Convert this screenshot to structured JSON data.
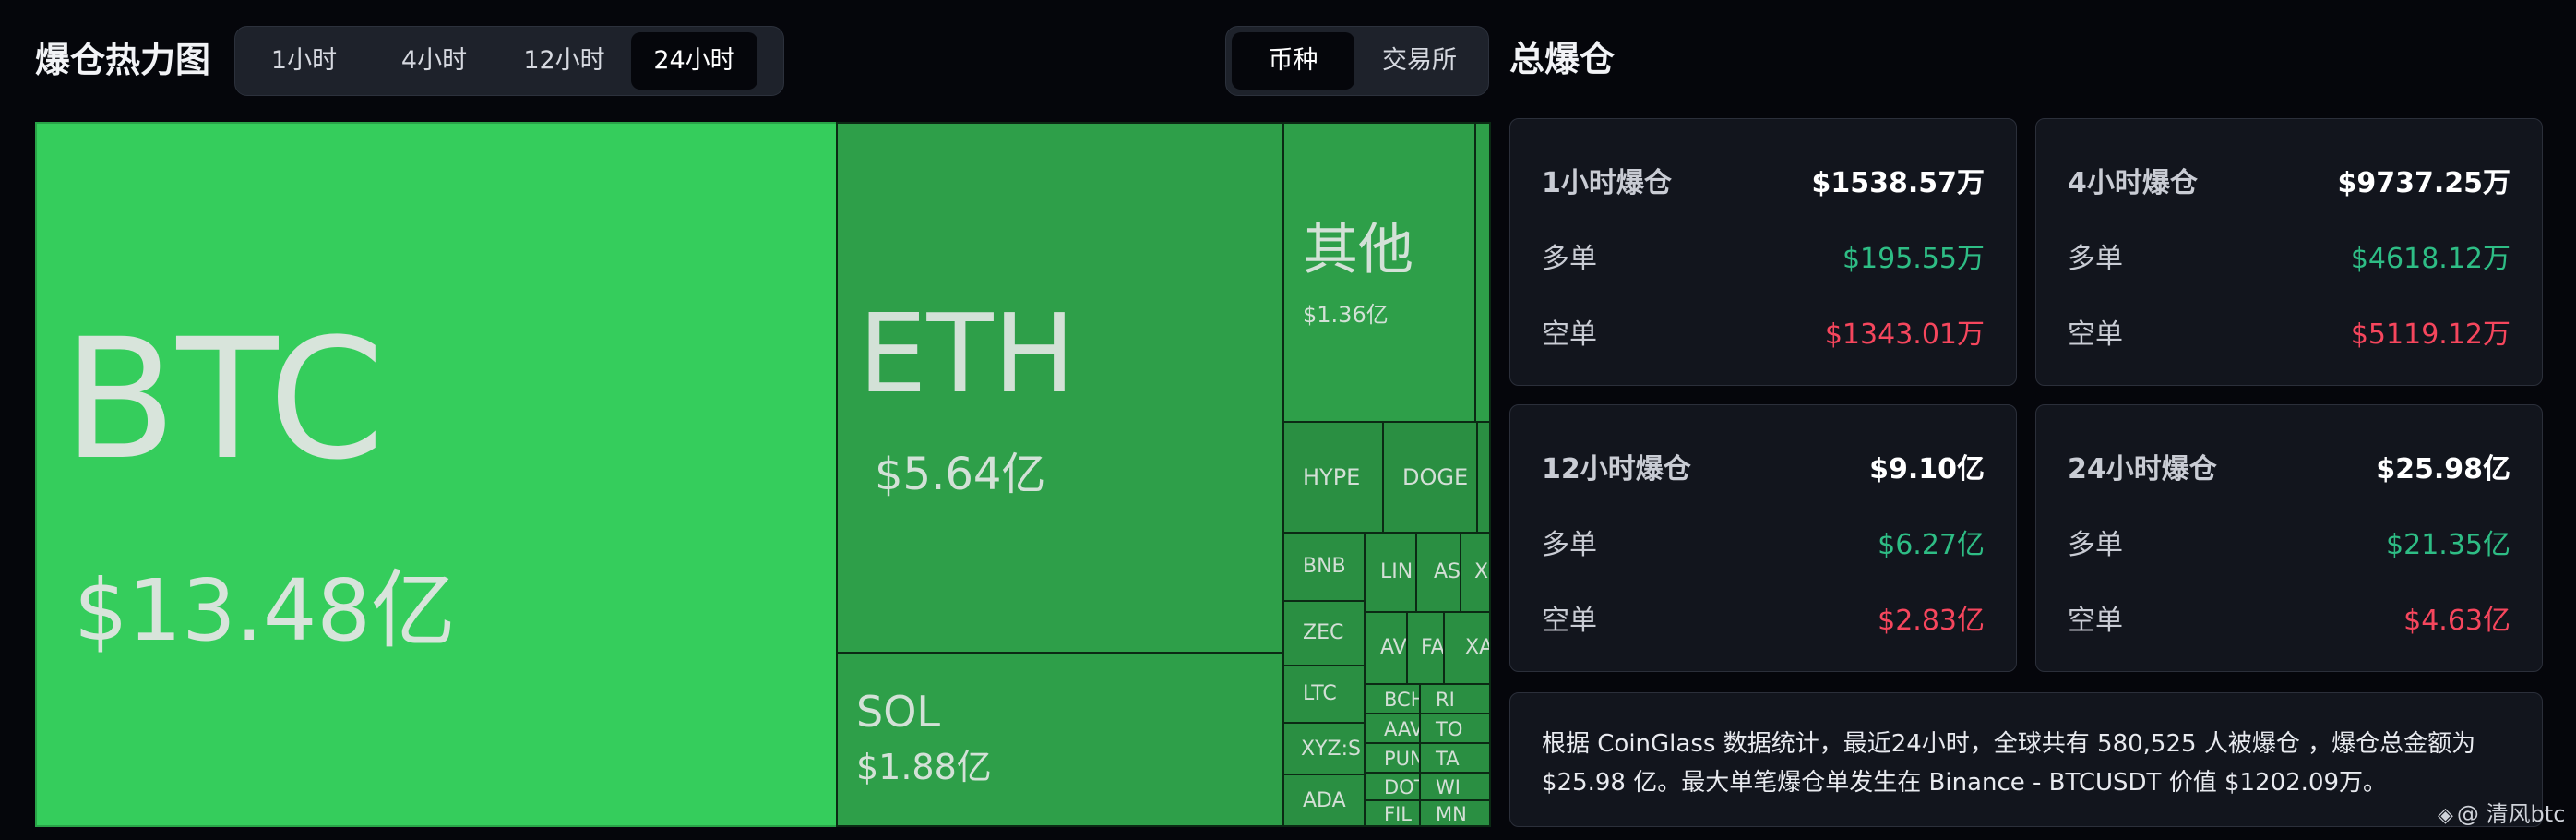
{
  "header": {
    "title": "爆仓热力图",
    "time_tabs": [
      "1小时",
      "4小时",
      "12小时",
      "24小时"
    ],
    "active_time_tab": "24小时",
    "view_tabs": [
      "币种",
      "交易所"
    ],
    "active_view_tab": "币种",
    "summary_title": "总爆仓"
  },
  "treemap": {
    "tiles": [
      {
        "symbol": "BTC",
        "value": "$13.48亿"
      },
      {
        "symbol": "ETH",
        "value": "$5.64亿"
      },
      {
        "symbol": "SOL",
        "value": "$1.88亿"
      },
      {
        "symbol": "其他",
        "value": "$1.36亿"
      },
      {
        "symbol": "HYPE",
        "value": ""
      },
      {
        "symbol": "DOGE",
        "value": ""
      },
      {
        "symbol": "BNB",
        "value": ""
      },
      {
        "symbol": "ZEC",
        "value": ""
      },
      {
        "symbol": "LTC",
        "value": ""
      },
      {
        "symbol": "XYZ:S",
        "value": ""
      },
      {
        "symbol": "ADA",
        "value": ""
      },
      {
        "symbol": "LIN",
        "value": ""
      },
      {
        "symbol": "AS",
        "value": ""
      },
      {
        "symbol": "X",
        "value": ""
      },
      {
        "symbol": "AV",
        "value": ""
      },
      {
        "symbol": "FA",
        "value": ""
      },
      {
        "symbol": "XA",
        "value": ""
      },
      {
        "symbol": "BCH",
        "value": ""
      },
      {
        "symbol": "RI",
        "value": ""
      },
      {
        "symbol": "AAV",
        "value": ""
      },
      {
        "symbol": "TO",
        "value": ""
      },
      {
        "symbol": "PUN",
        "value": ""
      },
      {
        "symbol": "TA",
        "value": ""
      },
      {
        "symbol": "DOT",
        "value": ""
      },
      {
        "symbol": "WI",
        "value": ""
      },
      {
        "symbol": "FIL",
        "value": ""
      },
      {
        "symbol": "MN",
        "value": ""
      }
    ]
  },
  "cards": [
    {
      "label": "1小时爆仓",
      "total": "$1538.57万",
      "long_label": "多单",
      "long": "$195.55万",
      "short_label": "空单",
      "short": "$1343.01万"
    },
    {
      "label": "4小时爆仓",
      "total": "$9737.25万",
      "long_label": "多单",
      "long": "$4618.12万",
      "short_label": "空单",
      "short": "$5119.12万"
    },
    {
      "label": "12小时爆仓",
      "total": "$9.10亿",
      "long_label": "多单",
      "long": "$6.27亿",
      "short_label": "空单",
      "short": "$2.83亿"
    },
    {
      "label": "24小时爆仓",
      "total": "$25.98亿",
      "long_label": "多单",
      "long": "$21.35亿",
      "short_label": "空单",
      "short": "$4.63亿"
    }
  ],
  "description": {
    "line1": "根据 CoinGlass 数据统计，最近24小时，全球共有 580,525 人被爆仓 ，爆仓总金额为",
    "line2": "$25.98 亿。最大单笔爆仓单发生在 Binance - BTCUSDT 价值 $1202.09万。"
  },
  "watermark": "@ 清风btc",
  "colors": {
    "background": "#05060b",
    "btc_tile": "#35cd5c",
    "major_tile": "#2e9f49",
    "minor_tile": "#2a8f42",
    "long_green": "#2ebd85",
    "short_red": "#f6465d"
  }
}
